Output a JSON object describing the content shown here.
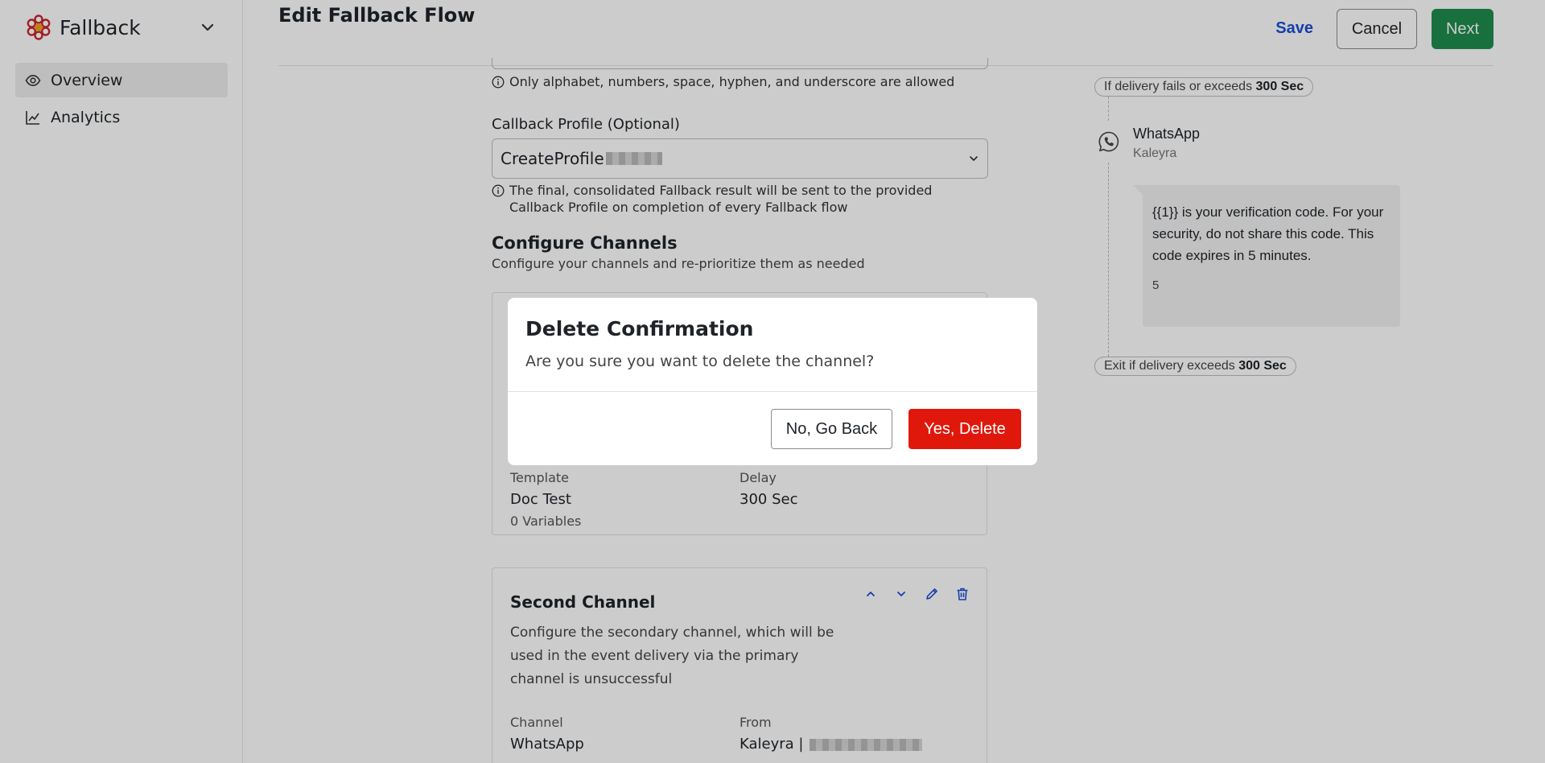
{
  "app": {
    "name": "Fallback",
    "brand_color": "#c8262c"
  },
  "sidebar": {
    "items": [
      {
        "label": "Overview",
        "icon": "eye-icon",
        "active": true
      },
      {
        "label": "Analytics",
        "icon": "line-chart-icon",
        "active": false
      }
    ]
  },
  "header": {
    "title": "Edit Fallback Flow",
    "save_label": "Save",
    "cancel_label": "Cancel",
    "next_label": "Next"
  },
  "form": {
    "name_hint": "Only alphabet, numbers, space, hyphen, and underscore are allowed",
    "callback_label": "Callback Profile (Optional)",
    "callback_value": "CreateProfile",
    "callback_hint": "The final, consolidated Fallback result will be sent to the provided Callback Profile on completion of every Fallback flow",
    "section_title": "Configure Channels",
    "section_subtitle": "Configure your channels and re-prioritize them as needed"
  },
  "first_channel": {
    "template_label": "Template",
    "template_value": "Doc Test",
    "variables": "0 Variables",
    "delay_label": "Delay",
    "delay_value": "300 Sec"
  },
  "second_channel": {
    "title": "Second Channel",
    "description": "Configure the secondary channel, which will be used in the event delivery via the primary channel is unsuccessful",
    "channel_label": "Channel",
    "channel_value": "WhatsApp",
    "from_label": "From",
    "from_value": "Kaleyra |"
  },
  "preview": {
    "fail_prefix": "If delivery fails or exceeds",
    "fail_value": "300 Sec",
    "channel_name": "WhatsApp",
    "provider": "Kaleyra",
    "message": "{{1}} is your verification code. For your security, do not share this code. This code expires in 5 minutes.",
    "message_footer": "5",
    "exit_prefix": "Exit if delivery exceeds",
    "exit_value": "300 Sec"
  },
  "modal": {
    "title": "Delete Confirmation",
    "message": "Are you sure you want to delete the channel?",
    "back_label": "No, Go Back",
    "delete_label": "Yes, Delete",
    "delete_color": "#e0180c"
  }
}
